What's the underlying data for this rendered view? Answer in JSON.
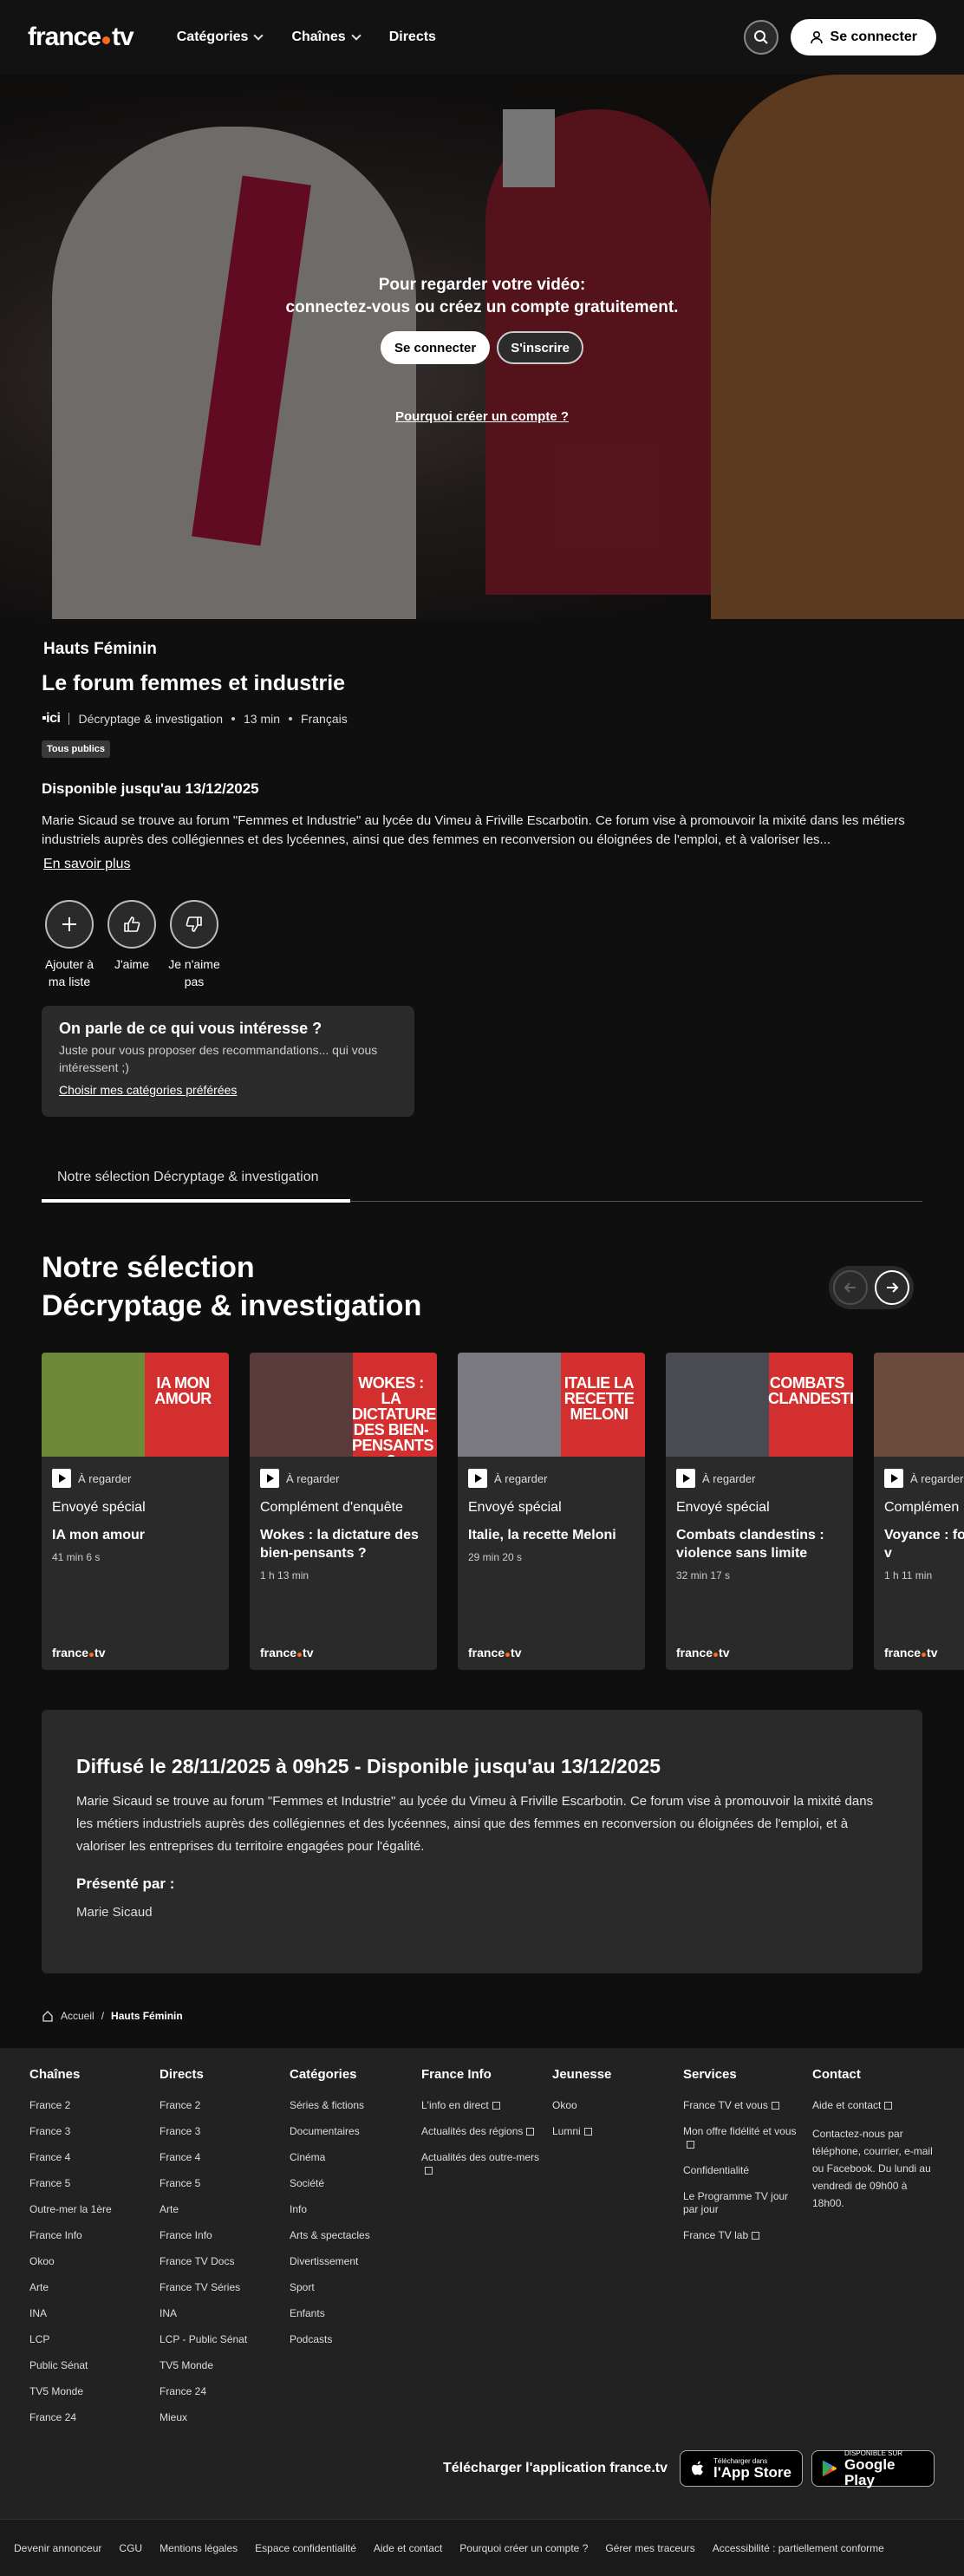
{
  "header": {
    "logo": {
      "part1": "france",
      "part2": "tv"
    },
    "nav": [
      {
        "label": "Catégories",
        "has_dropdown": true
      },
      {
        "label": "Chaînes",
        "has_dropdown": true
      },
      {
        "label": "Directs",
        "has_dropdown": false
      }
    ],
    "search_icon": "search-icon",
    "connect_label": "Se connecter"
  },
  "hero": {
    "message_line1": "Pour regarder votre vidéo:",
    "message_line2": "connectez-vous ou créez un compte gratuitement.",
    "login_label": "Se connecter",
    "signup_label": "S'inscrire",
    "why_link": "Pourquoi créer un compte ?"
  },
  "program": {
    "show": "Hauts Féminin",
    "title": "Le forum femmes et industrie",
    "channel_logo": "ici",
    "category": "Décryptage & investigation",
    "duration": "13 min",
    "language": "Français",
    "rating": "Tous publics",
    "availability": "Disponible jusqu'au 13/12/2025",
    "description": "Marie Sicaud se trouve au forum \"Femmes et Industrie\" au lycée du Vimeu à Friville Escarbotin. Ce forum vise à promouvoir la mixité dans les métiers industriels auprès des collégiennes et des lycéennes, ainsi que des femmes en reconversion ou éloignées de l'emploi, et à valoriser les...",
    "more_link": "En savoir plus",
    "actions": [
      {
        "label": "Ajouter à ma liste",
        "icon": "plus-icon"
      },
      {
        "label": "J'aime",
        "icon": "thumbs-up-icon"
      },
      {
        "label": "Je n'aime pas",
        "icon": "thumbs-down-icon"
      }
    ]
  },
  "promo": {
    "title": "On parle de ce qui vous intéresse ?",
    "text": "Juste pour vous proposer des recommandations... qui vous intéressent ;)",
    "link": "Choisir mes catégories préférées"
  },
  "tabs": [
    {
      "label": "Notre sélection Décryptage & investigation",
      "active": true
    }
  ],
  "selection": {
    "title_line1": "Notre sélection",
    "title_line2": "Décryptage & investigation",
    "cards": [
      {
        "badge": "À regarder",
        "show": "Envoyé spécial",
        "title": "IA mon amour",
        "duration": "41 min 6 s",
        "thumb_text": "IA MON AMOUR",
        "thumb_color": "#6d8a3a",
        "logo": "france.tv"
      },
      {
        "badge": "À regarder",
        "show": "Complément d'enquête",
        "title": "Wokes : la dictature des bien-pensants ?",
        "duration": "1 h 13 min",
        "thumb_text": "WOKES : LA DICTATURE DES BIEN-PENSANTS ?",
        "thumb_color": "#5a3b3b",
        "logo": "france.tv"
      },
      {
        "badge": "À regarder",
        "show": "Envoyé spécial",
        "title": "Italie, la recette Meloni",
        "duration": "29 min 20 s",
        "thumb_text": "ITALIE LA RECETTE MELONI",
        "thumb_color": "#7a7a80",
        "logo": "france.tv"
      },
      {
        "badge": "À regarder",
        "show": "Envoyé spécial",
        "title": "Combats clandestins : violence sans limite",
        "duration": "32 min 17 s",
        "thumb_text": "COMBATS CLANDESTINS",
        "thumb_color": "#4a4a52",
        "logo": "france.tv"
      },
      {
        "badge": "À regarder",
        "show": "Complémen",
        "title": "Voyance : fo prophètes, v",
        "duration": "1 h 11 min",
        "thumb_text": "",
        "thumb_color": "#6a4a3a",
        "logo": "france.tv"
      }
    ]
  },
  "broadcast": {
    "title": "Diffusé le 28/11/2025 à 09h25 - Disponible jusqu'au 13/12/2025",
    "text": "Marie Sicaud se trouve au forum \"Femmes et Industrie\" au lycée du Vimeu à Friville Escarbotin. Ce forum vise à promouvoir la mixité dans les métiers industriels auprès des collégiennes et des lycéennes, ainsi que des femmes en reconversion ou éloignées de l'emploi, et à valoriser les entreprises du territoire engagées pour l'égalité.",
    "presented_by": "Présenté par :",
    "presenter": "Marie Sicaud"
  },
  "breadcrumb": {
    "home": "Accueil",
    "current": "Hauts Féminin"
  },
  "footer": {
    "columns": [
      {
        "title": "Chaînes",
        "links": [
          "France 2",
          "France 3",
          "France 4",
          "France 5",
          "Outre-mer la 1ère",
          "France Info",
          "Okoo",
          "Arte",
          "INA",
          "LCP",
          "Public Sénat",
          "TV5 Monde",
          "France 24"
        ]
      },
      {
        "title": "Directs",
        "links": [
          "France 2",
          "France 3",
          "France 4",
          "France 5",
          "Arte",
          "France Info",
          "France TV Docs",
          "France TV Séries",
          "INA",
          "LCP - Public Sénat",
          "TV5 Monde",
          "France 24",
          "Mieux"
        ]
      },
      {
        "title": "Catégories",
        "links": [
          "Séries & fictions",
          "Documentaires",
          "Cinéma",
          "Société",
          "Info",
          "Arts & spectacles",
          "Divertissement",
          "Sport",
          "Enfants",
          "Podcasts"
        ]
      },
      {
        "title": "France Info",
        "links": [
          "L'info en direct",
          "Actualités des régions",
          "Actualités des outre-mers"
        ]
      },
      {
        "title": "Jeunesse",
        "links": [
          "Okoo",
          "Lumni"
        ]
      },
      {
        "title": "Services",
        "links": [
          "France TV et vous",
          "Mon offre fidélité et vous",
          "Confidentialité",
          "Le Programme TV jour par jour",
          "France TV lab"
        ]
      },
      {
        "title": "Contact",
        "links": [
          "Aide et contact"
        ],
        "text": "Contactez-nous par téléphone, courrier, e-mail ou Facebook. Du lundi au vendredi de 09h00 à 18h00."
      }
    ],
    "app_text": "Télécharger l'application france.tv",
    "app_store": {
      "small": "Télécharger dans",
      "big": "l'App Store"
    },
    "google_play": {
      "small": "DISPONIBLE SUR",
      "big": "Google Play"
    },
    "bottom_links": [
      "Devenir annonceur",
      "CGU",
      "Mentions légales",
      "Espace confidentialité",
      "Aide et contact",
      "Pourquoi créer un compte ?",
      "Gérer mes traceurs",
      "Accessibilité : partiellement conforme"
    ]
  }
}
